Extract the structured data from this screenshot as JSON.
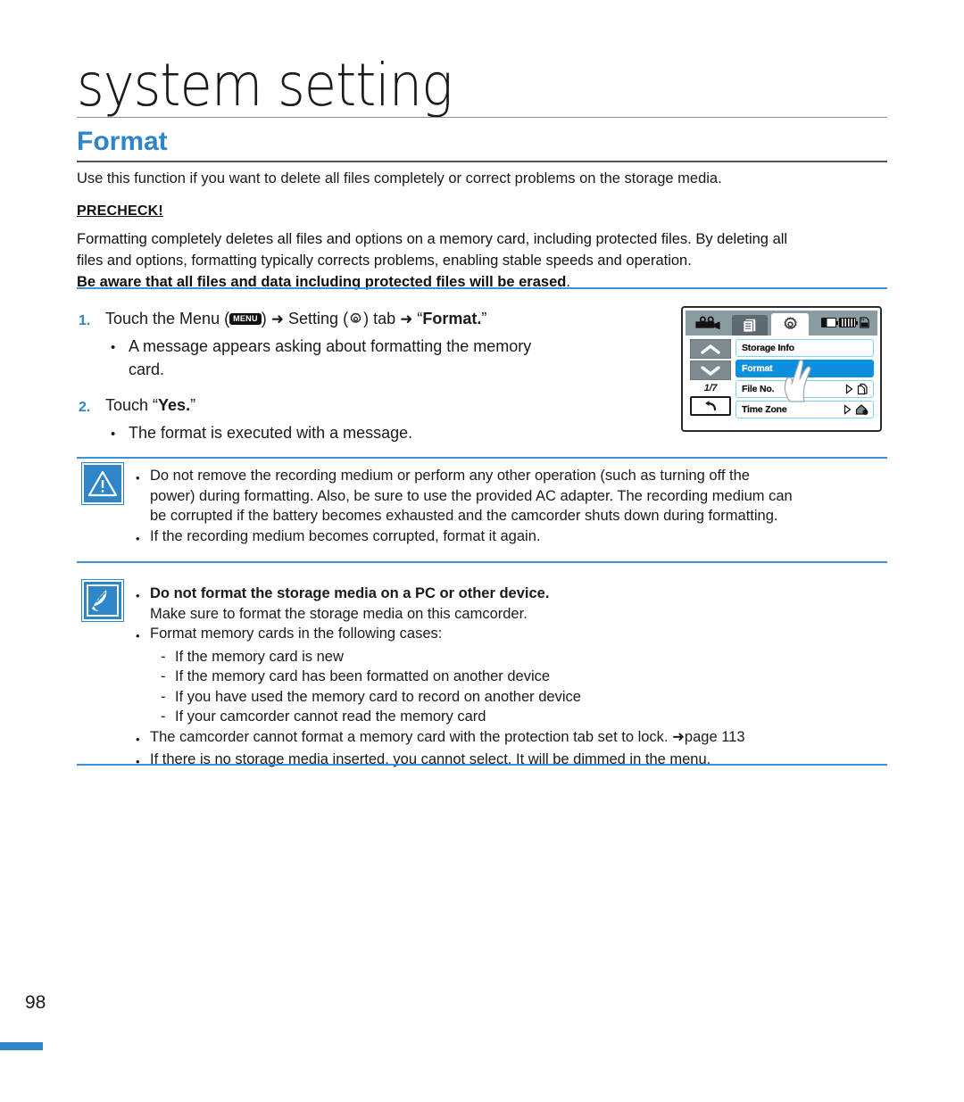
{
  "header": {
    "chapter_title": "system setting",
    "section_title": "Format",
    "intro": "Use this function if you want to delete all files completely or correct problems on the storage media."
  },
  "precheck": {
    "label": "PRECHECK!",
    "line1": "Formatting completely deletes all files and options on a memory card, including protected files. By deleting all",
    "line2": "files and options, formatting typically corrects problems, enabling stable speeds and operation.",
    "line3_bold": "Be aware that all files and data including protected files will be erased",
    "line3_tail": "."
  },
  "steps": {
    "step1": {
      "num": "1.",
      "text_pre": "Touch the Menu (",
      "menu_badge": "MENU",
      "text_mid": ") ",
      "arrow1": "➜",
      "text_setting": " Setting (",
      "gear_icon": "gear-icon",
      "text_tab": ") tab ",
      "arrow2": "➜",
      "text_quote": " “",
      "bold_target": "Format.",
      "text_endquote": "”"
    },
    "step1_sub_bullet": "•",
    "step1_sub_line1": "A message appears asking about formatting the memory",
    "step1_sub_line2": "card.",
    "step2": {
      "num": "2.",
      "text_pre": "Touch “",
      "bold_target": "Yes.",
      "text_post": "”"
    },
    "step2_sub_bullet": "•",
    "step2_sub_line1": "The format is executed with a message."
  },
  "lcd": {
    "icons": {
      "camcorder": "camcorder-icon",
      "tab_list": "list-tab-icon",
      "tab_gear": "gear-tab-icon",
      "battery_low": "battery-low-icon",
      "battery_full": "battery-full-icon",
      "sd_card": "sd-card-icon",
      "up": "chevron-up-icon",
      "down": "chevron-down-icon",
      "back": "back-arrow-icon"
    },
    "page_count": "1/7",
    "rows": [
      {
        "label": "Storage Info",
        "selected": false,
        "has_arrow": false,
        "right_icon": ""
      },
      {
        "label": "Format",
        "selected": true,
        "has_arrow": false,
        "right_icon": ""
      },
      {
        "label": "File No.",
        "selected": false,
        "has_arrow": true,
        "right_icon": "file-icon"
      },
      {
        "label": "Time Zone",
        "selected": false,
        "has_arrow": true,
        "right_icon": "home-clock-icon"
      }
    ]
  },
  "caution": {
    "icon": "warning-triangle-icon",
    "bullet": "•",
    "b1_line1": "Do not remove the recording medium or perform any other operation (such as turning off the",
    "b1_line2": "power) during formatting. Also, be sure to use the provided AC adapter. The recording medium can",
    "b1_line3": "be corrupted if the battery becomes exhausted and the camcorder shuts down during formatting.",
    "b2_line1": "If the recording medium becomes corrupted, format it again."
  },
  "note": {
    "icon": "note-pen-icon",
    "bullet": "•",
    "dash": "-",
    "b1_bold": "Do not format the storage media on a PC or other device.",
    "b1_sub": "Make sure to format the storage media on this camcorder.",
    "b2": "Format memory cards in the following cases:",
    "sub_items": [
      "If the memory card is new",
      "If the memory card has been formatted on another device",
      "If you have used the memory card to record on another device",
      "If your camcorder cannot read the memory card"
    ],
    "b3_pre": "The camcorder cannot format a memory card with the protection tab set to lock. ",
    "b3_arrow": "➜",
    "b3_page": "page 113",
    "b4": "If there is no storage media inserted, you cannot select. It will be dimmed in the menu."
  },
  "footer": {
    "page_number": "98"
  },
  "colors": {
    "accent_blue": "#2e86c8",
    "rule_blue": "#3b93d4",
    "lcd_selected": "#0d8fe0"
  }
}
